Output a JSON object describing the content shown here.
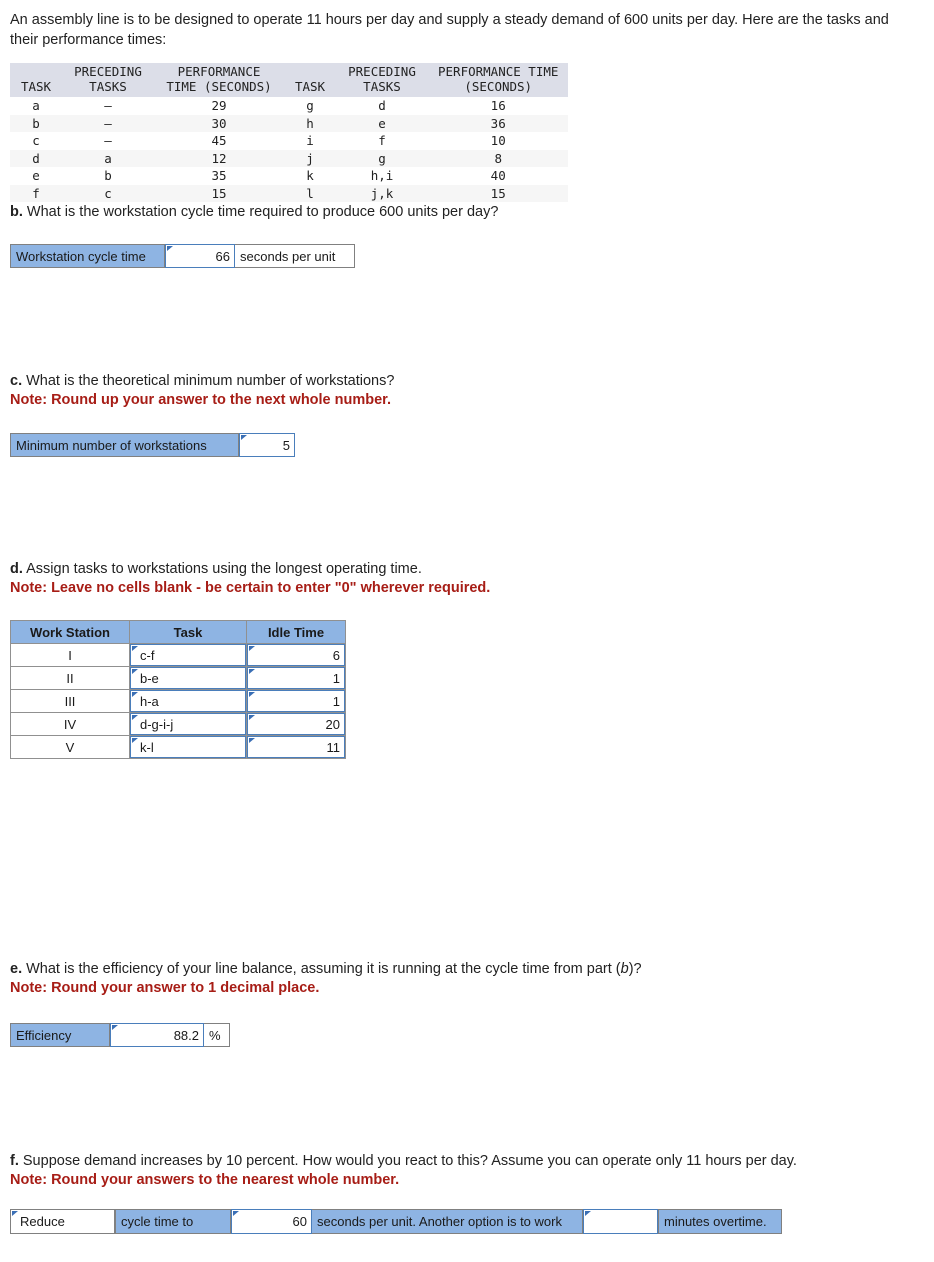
{
  "intro": "An assembly line is to be designed to operate 11 hours per day and supply a steady demand of 600 units per day. Here are the tasks and their performance times:",
  "task_table": {
    "headers": {
      "task_left": "TASK",
      "preceding_left_l1": "PRECEDING",
      "preceding_left_l2": "TASKS",
      "performance_left_l1": "PERFORMANCE",
      "performance_left_l2": "TIME (SECONDS)",
      "task_right": "TASK",
      "preceding_right_l1": "PRECEDING",
      "preceding_right_l2": "TASKS",
      "performance_right_l1": "PERFORMANCE TIME",
      "performance_right_l2": "(SECONDS)"
    },
    "rows": [
      {
        "task_l": "a",
        "prec_l": "–",
        "time_l": "29",
        "task_r": "g",
        "prec_r": "d",
        "time_r": "16"
      },
      {
        "task_l": "b",
        "prec_l": "–",
        "time_l": "30",
        "task_r": "h",
        "prec_r": "e",
        "time_r": "36"
      },
      {
        "task_l": "c",
        "prec_l": "–",
        "time_l": "45",
        "task_r": "i",
        "prec_r": "f",
        "time_r": "10"
      },
      {
        "task_l": "d",
        "prec_l": "a",
        "time_l": "12",
        "task_r": "j",
        "prec_r": "g",
        "time_r": "8"
      },
      {
        "task_l": "e",
        "prec_l": "b",
        "time_l": "35",
        "task_r": "k",
        "prec_r": "h,i",
        "time_r": "40"
      },
      {
        "task_l": "f",
        "prec_l": "c",
        "time_l": "15",
        "task_r": "l",
        "prec_r": "j,k",
        "time_r": "15"
      }
    ]
  },
  "part_b": {
    "letter": "b.",
    "question": " What is the workstation cycle time required to produce 600 units per day?",
    "label": "Workstation cycle time",
    "value": "66",
    "unit": "seconds per unit"
  },
  "part_c": {
    "letter": "c.",
    "question": " What is the theoretical minimum number of workstations?",
    "note": "Note: Round up your answer to the next whole number.",
    "label": "Minimum number of workstations",
    "value": "5"
  },
  "part_d": {
    "letter": "d.",
    "question": " Assign tasks to workstations using the longest operating time.",
    "note": "Note: Leave no cells blank - be certain to enter \"0\" wherever required.",
    "headers": [
      "Work Station",
      "Task",
      "Idle Time"
    ],
    "rows": [
      {
        "station": "I",
        "task": "c-f",
        "idle": "6"
      },
      {
        "station": "II",
        "task": "b-e",
        "idle": "1"
      },
      {
        "station": "III",
        "task": "h-a",
        "idle": "1"
      },
      {
        "station": "IV",
        "task": "d-g-i-j",
        "idle": "20"
      },
      {
        "station": "V",
        "task": "k-l",
        "idle": "11"
      }
    ]
  },
  "part_e": {
    "letter": "e.",
    "question_pre": " What is the efficiency of your line balance, assuming it is running at the cycle time from part (",
    "question_italic": "b",
    "question_post": ")?",
    "note": "Note: Round your answer to 1 decimal place.",
    "label": "Efficiency",
    "value": "88.2",
    "unit": "%"
  },
  "part_f": {
    "letter": "f.",
    "question": " Suppose demand increases by 10 percent. How would you react to this? Assume you can operate only 11 hours per day.",
    "note": "Note: Round your answers to the nearest whole number.",
    "select_value": "Reduce",
    "label_1": "cycle time to",
    "value_1": "60",
    "label_2": "seconds per unit. Another option is to work",
    "value_2": "",
    "label_3": "minutes overtime."
  },
  "colors": {
    "blue_cell": "#8eb4e3",
    "header_gray": "#dcdee8",
    "note_red": "#a71d16",
    "input_border": "#4a7ebb"
  }
}
